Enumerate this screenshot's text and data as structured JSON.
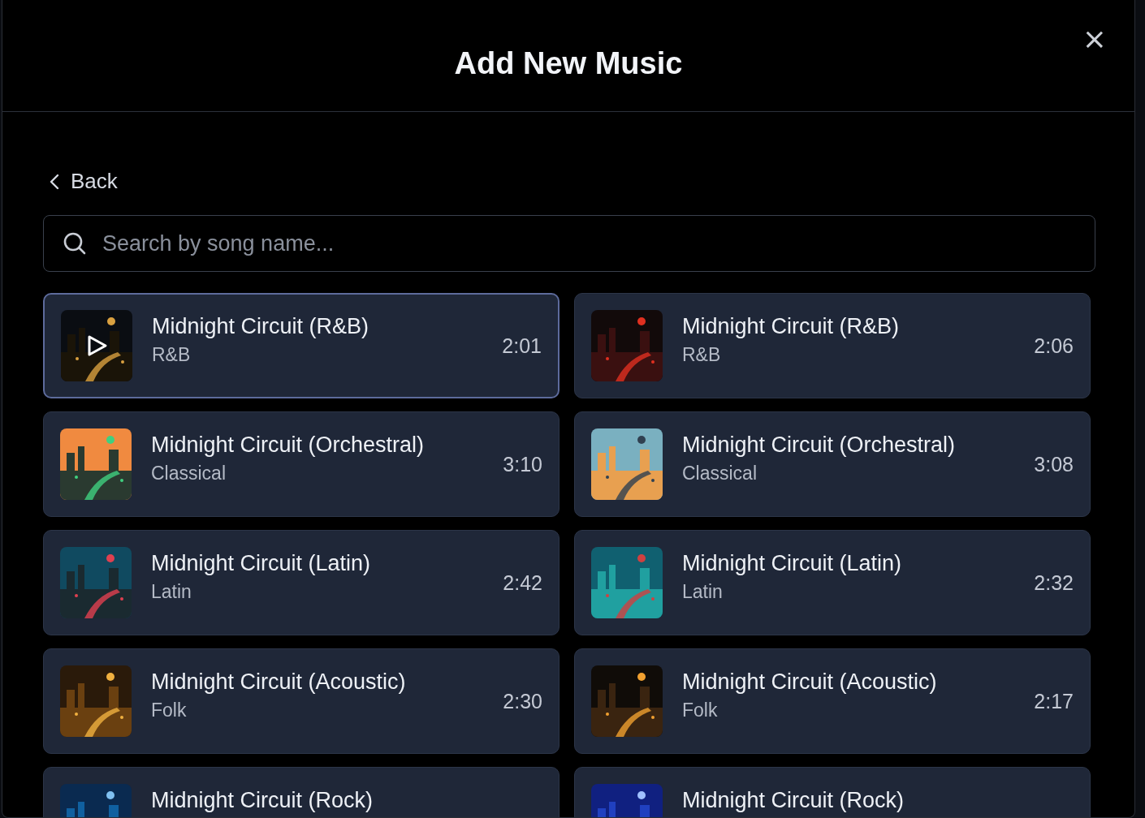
{
  "dialog": {
    "title": "Add New Music",
    "close": "×"
  },
  "back": {
    "label": "Back"
  },
  "search": {
    "placeholder": "Search by song name..."
  },
  "songs": [
    {
      "title": "Midnight Circuit (R&B)",
      "genre": "R&B",
      "duration": "2:01",
      "selected": true
    },
    {
      "title": "Midnight Circuit (R&B)",
      "genre": "R&B",
      "duration": "2:06",
      "selected": false
    },
    {
      "title": "Midnight Circuit (Orchestral)",
      "genre": "Classical",
      "duration": "3:10",
      "selected": false
    },
    {
      "title": "Midnight Circuit (Orchestral)",
      "genre": "Classical",
      "duration": "3:08",
      "selected": false
    },
    {
      "title": "Midnight Circuit (Latin)",
      "genre": "Latin",
      "duration": "2:42",
      "selected": false
    },
    {
      "title": "Midnight Circuit (Latin)",
      "genre": "Latin",
      "duration": "2:32",
      "selected": false
    },
    {
      "title": "Midnight Circuit (Acoustic)",
      "genre": "Folk",
      "duration": "2:30",
      "selected": false
    },
    {
      "title": "Midnight Circuit (Acoustic)",
      "genre": "Folk",
      "duration": "2:17",
      "selected": false
    },
    {
      "title": "Midnight Circuit (Rock)",
      "selected": false
    },
    {
      "title": "Midnight Circuit (Rock)",
      "selected": false
    }
  ]
}
